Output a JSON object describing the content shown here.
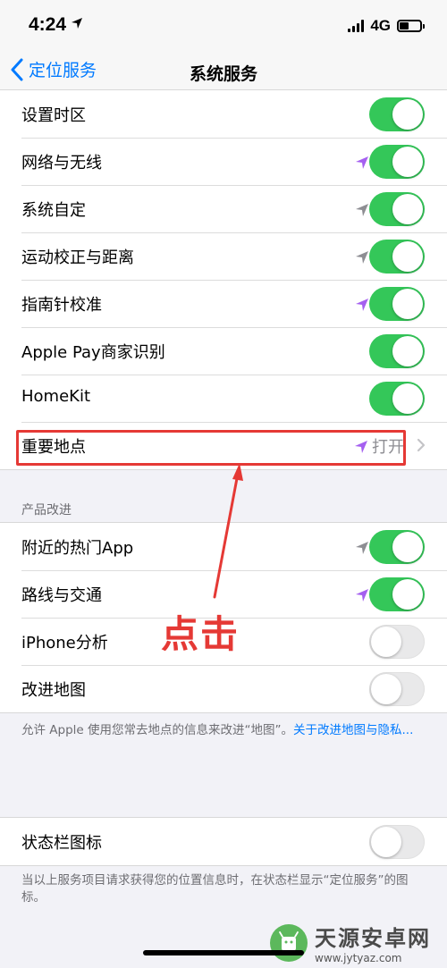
{
  "status_bar": {
    "time": "4:24",
    "network": "4G"
  },
  "nav": {
    "back_label": "定位服务",
    "title": "系统服务"
  },
  "group1": [
    {
      "label": "设置时区",
      "toggle": true,
      "location_icon": "none"
    },
    {
      "label": "网络与无线",
      "toggle": true,
      "location_icon": "purple"
    },
    {
      "label": "系统自定",
      "toggle": true,
      "location_icon": "gray"
    },
    {
      "label": "运动校正与距离",
      "toggle": true,
      "location_icon": "gray"
    },
    {
      "label": "指南针校准",
      "toggle": true,
      "location_icon": "purple"
    },
    {
      "label": "Apple Pay商家识别",
      "toggle": true,
      "location_icon": "none"
    },
    {
      "label": "HomeKit",
      "toggle": true,
      "location_icon": "none"
    },
    {
      "label": "重要地点",
      "value": "打开",
      "location_icon": "purple",
      "chevron": true
    }
  ],
  "section2_header": "产品改进",
  "group2": [
    {
      "label": "附近的热门App",
      "toggle": true,
      "location_icon": "gray"
    },
    {
      "label": "路线与交通",
      "toggle": true,
      "location_icon": "purple"
    },
    {
      "label": "iPhone分析",
      "toggle": false,
      "location_icon": "none"
    },
    {
      "label": "改进地图",
      "toggle": false,
      "location_icon": "none"
    }
  ],
  "footer1": {
    "text": "允许 Apple 使用您常去地点的信息来改进“地图”。",
    "link": "关于改进地图与隐私..."
  },
  "group3": [
    {
      "label": "状态栏图标",
      "toggle": false
    }
  ],
  "footer2": "当以上服务项目请求获得您的位置信息时，在状态栏显示“定位服务”的图标。",
  "annotation": {
    "text": "点击"
  },
  "watermark": {
    "title": "天源安卓网",
    "url": "www.jytyaz.com"
  },
  "colors": {
    "toggle_on": "#34c759",
    "toggle_off": "#e9e9ea",
    "link": "#007aff",
    "location_purple": "#a560f0",
    "location_gray": "#8e8e93",
    "annotation_red": "#e53935"
  }
}
